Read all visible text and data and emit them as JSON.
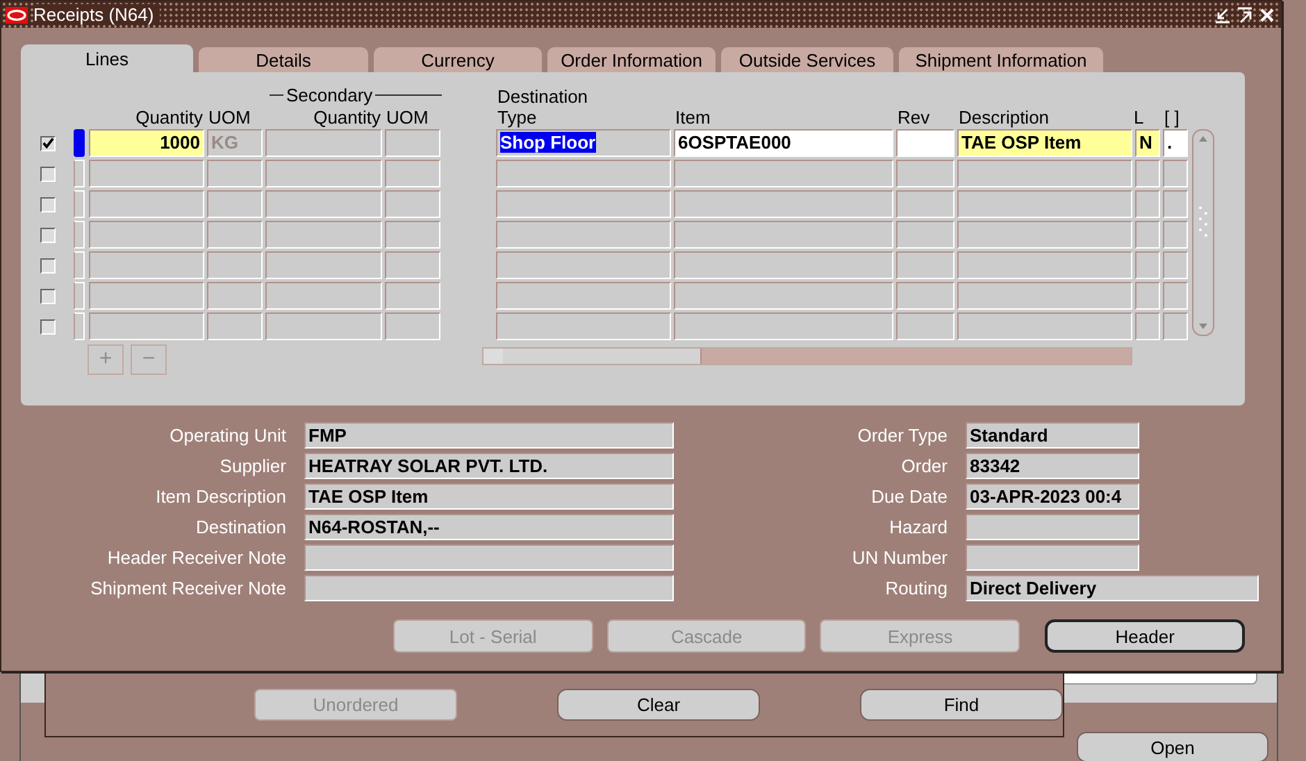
{
  "window": {
    "title": "Receipts (N64)"
  },
  "tabs": [
    {
      "label": "Lines",
      "selected": true
    },
    {
      "label": "Details",
      "selected": false
    },
    {
      "label": "Currency",
      "selected": false
    },
    {
      "label": "Order Information",
      "selected": false
    },
    {
      "label": "Outside Services",
      "selected": false
    },
    {
      "label": "Shipment Information",
      "selected": false
    }
  ],
  "lines": {
    "column_group": {
      "label": "Secondary"
    },
    "columns": [
      {
        "label": "Quantity"
      },
      {
        "label": "UOM"
      },
      {
        "label": "Quantity"
      },
      {
        "label": "UOM"
      },
      {
        "label": "Destination\nType"
      },
      {
        "label": "Item"
      },
      {
        "label": "Rev"
      },
      {
        "label": "Description"
      },
      {
        "label": "L"
      },
      {
        "label": "[ ]"
      }
    ],
    "rows": [
      {
        "checked": true,
        "current": true,
        "cells": [
          {
            "text": "1000",
            "kind": "required"
          },
          {
            "text": "KG",
            "kind": "readonly"
          },
          {
            "kind": "readonly"
          },
          {
            "kind": "readonly"
          },
          {
            "text": "Shop Floor",
            "kind": "highlighted"
          },
          {
            "text": "6OSPTAE000",
            "kind": "editable"
          },
          {
            "kind": "editable"
          },
          {
            "text": "TAE OSP Item",
            "kind": "required"
          },
          {
            "text": "N",
            "kind": "required"
          },
          {
            "text": ".",
            "kind": "editable"
          }
        ]
      },
      {
        "checked": false,
        "current": false
      },
      {
        "checked": false,
        "current": false
      },
      {
        "checked": false,
        "current": false
      },
      {
        "checked": false,
        "current": false
      },
      {
        "checked": false,
        "current": false
      },
      {
        "checked": false,
        "current": false
      }
    ],
    "row_buttons": [
      {
        "label": "+",
        "disabled": true
      },
      {
        "label": "−",
        "disabled": true
      }
    ]
  },
  "fields": {
    "left": [
      {
        "label": "Operating Unit",
        "value": "FMP"
      },
      {
        "label": "Supplier",
        "value": "HEATRAY SOLAR PVT. LTD."
      },
      {
        "label": "Item Description",
        "value": "TAE OSP Item"
      },
      {
        "label": "Destination",
        "value": "N64-ROSTAN,--"
      },
      {
        "label": "Header Receiver Note"
      },
      {
        "label": "Shipment Receiver Note"
      }
    ],
    "right": [
      {
        "label": "Order Type",
        "value": "Standard"
      },
      {
        "label": "Order",
        "value": "83342"
      },
      {
        "label": "Due Date",
        "value": "03-APR-2023 00:4"
      },
      {
        "label": "Hazard"
      },
      {
        "label": "UN Number"
      },
      {
        "label": "Routing",
        "value": "Direct Delivery",
        "wide": true
      }
    ]
  },
  "buttons": [
    {
      "label": "Lot - Serial",
      "disabled": true,
      "default": false
    },
    {
      "label": "Cascade",
      "disabled": true,
      "default": false
    },
    {
      "label": "Express",
      "disabled": true,
      "default": false
    },
    {
      "label": "Header",
      "disabled": false,
      "default": true
    }
  ],
  "find_window": {
    "buttons": [
      {
        "label": "Unordered",
        "disabled": true
      },
      {
        "label": "Clear",
        "disabled": false
      },
      {
        "label": "Find",
        "disabled": false
      }
    ]
  },
  "back_window": {
    "buttons": [
      {
        "label": "Open",
        "disabled": false
      }
    ]
  }
}
